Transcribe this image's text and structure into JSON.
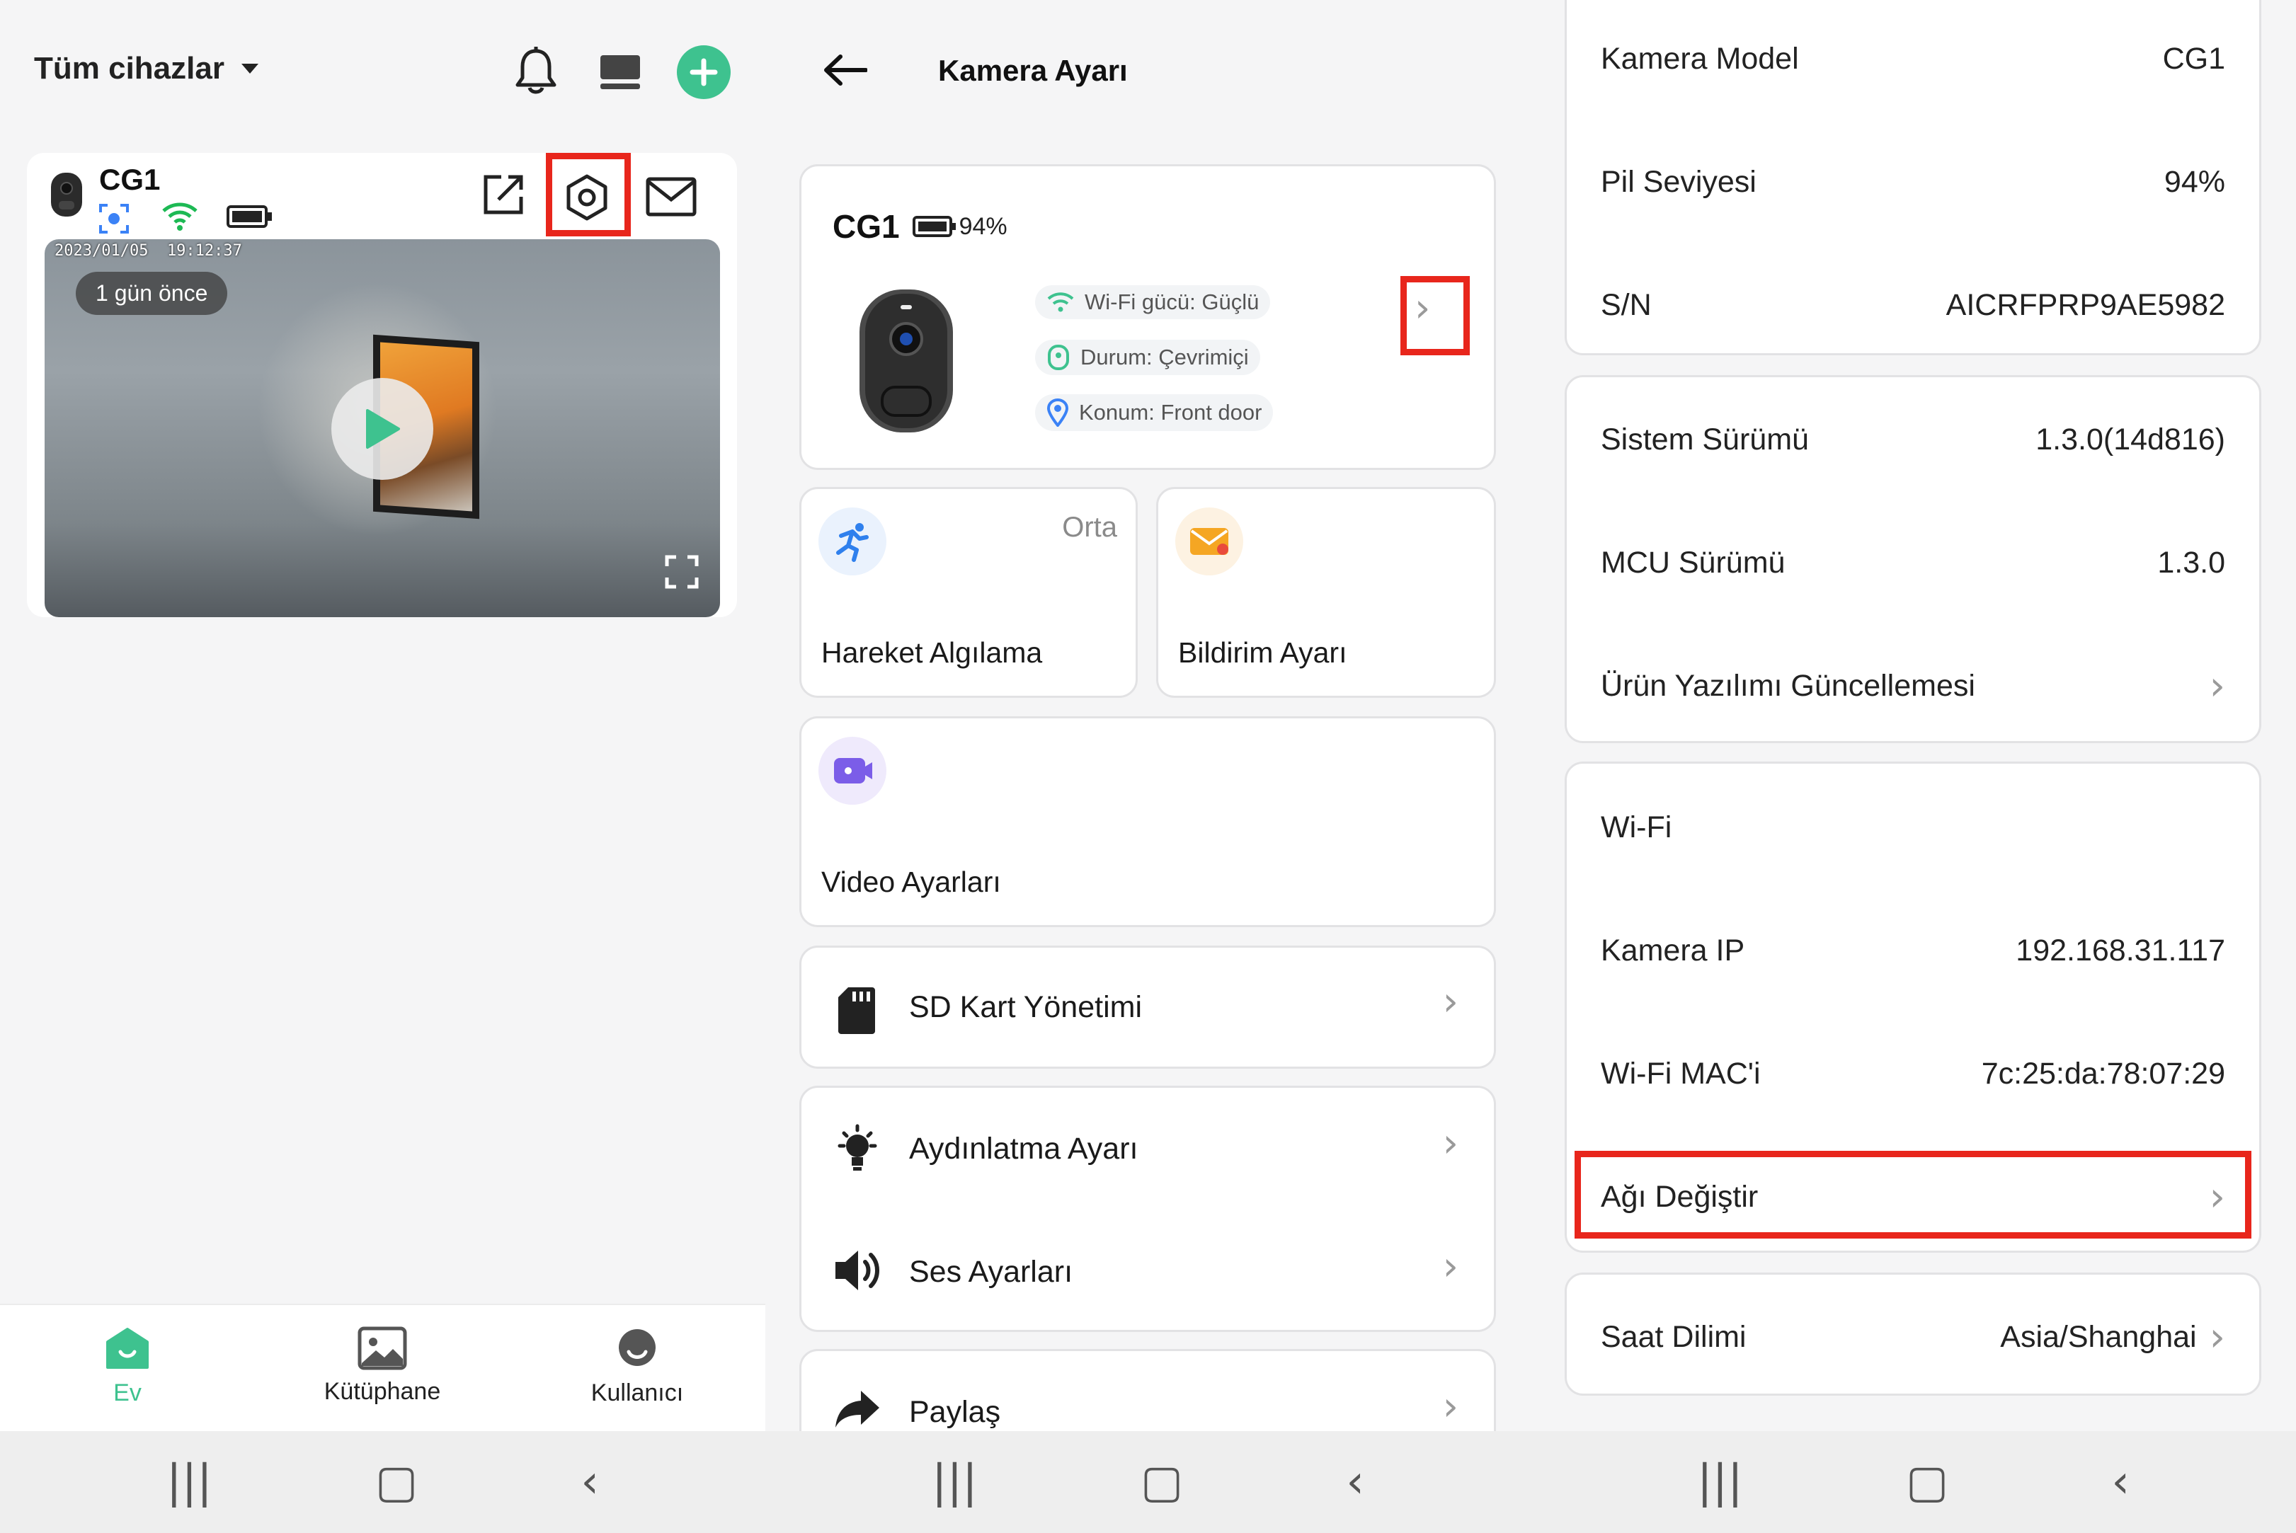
{
  "home": {
    "header_title": "Tüm cihazlar",
    "device": {
      "name": "CG1",
      "timestamp": "2023/01/05  19:12:37",
      "ago_badge": "1 gün önce"
    },
    "tabs": [
      {
        "label": "Ev",
        "active": true
      },
      {
        "label": "Kütüphane",
        "active": false
      },
      {
        "label": "Kullanıcı",
        "active": false
      }
    ]
  },
  "settings": {
    "title": "Kamera Ayarı",
    "device_name": "CG1",
    "battery": "94%",
    "wifi_strength": "Wi-Fi gücü: Güçlü",
    "status": "Durum: Çevrimiçi",
    "location": "Konum: Front door",
    "motion": {
      "label": "Hareket Algılama",
      "level": "Orta"
    },
    "notification": {
      "label": "Bildirim Ayarı"
    },
    "video": {
      "label": "Video Ayarları"
    },
    "sd_card": {
      "label": "SD Kart Yönetimi"
    },
    "lighting": {
      "label": "Aydınlatma Ayarı"
    },
    "sound": {
      "label": "Ses Ayarları"
    },
    "share": {
      "label": "Paylaş"
    }
  },
  "info": {
    "camera_model": {
      "label": "Kamera Model",
      "value": "CG1"
    },
    "battery_level": {
      "label": "Pil Seviyesi",
      "value": "94%"
    },
    "serial": {
      "label": "S/N",
      "value": "AICRFPRP9AE5982"
    },
    "system_version": {
      "label": "Sistem Sürümü",
      "value": "1.3.0(14d816)"
    },
    "mcu_version": {
      "label": "MCU Sürümü",
      "value": "1.3.0"
    },
    "firmware_update": {
      "label": "Ürün Yazılımı Güncellemesi"
    },
    "wifi": {
      "label": "Wi-Fi"
    },
    "camera_ip": {
      "label": "Kamera IP",
      "value": "192.168.31.117"
    },
    "wifi_mac": {
      "label": "Wi-Fi MAC'i",
      "value": "7c:25:da:78:07:29"
    },
    "change_network": {
      "label": "Ağı Değiştir"
    },
    "timezone": {
      "label": "Saat Dilimi",
      "value": "Asia/Shanghai"
    }
  },
  "colors": {
    "accent_green": "#3ec28f",
    "highlight_red": "#e8261c",
    "wifi_green": "#1db954"
  }
}
